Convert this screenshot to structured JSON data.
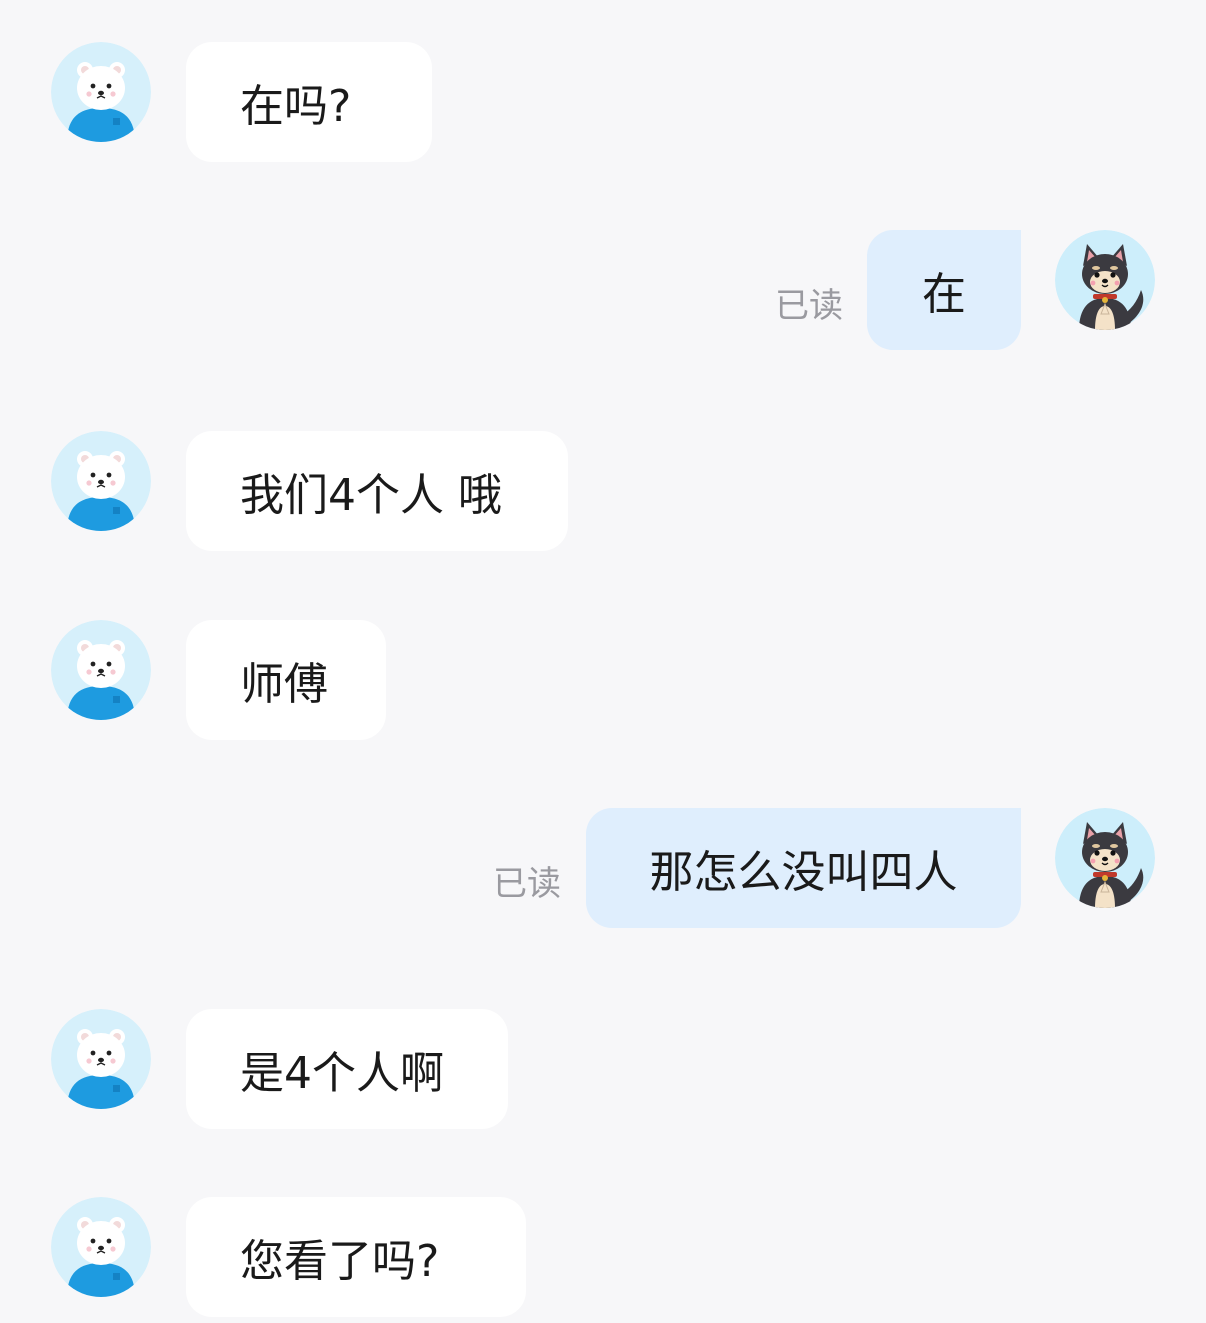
{
  "conversation": {
    "messages": [
      {
        "sender": "other",
        "text": "在吗?"
      },
      {
        "sender": "me",
        "text": "在",
        "status": "已读"
      },
      {
        "sender": "other",
        "text": "我们4个人 哦"
      },
      {
        "sender": "other",
        "text": "师傅"
      },
      {
        "sender": "me",
        "text": "那怎么没叫四人",
        "status": "已读"
      },
      {
        "sender": "other",
        "text": "是4个人啊"
      },
      {
        "sender": "other",
        "text": "您看了吗?"
      }
    ]
  },
  "avatars": {
    "other": {
      "icon": "polar-bear-avatar-icon",
      "bg_color": "#d6f0fb",
      "shirt_color": "#1e9be0"
    },
    "me": {
      "icon": "shiba-dog-avatar-icon",
      "bg_color": "#cdeefb",
      "fur_color": "#3b3a40"
    }
  },
  "colors": {
    "background": "#f7f7f9",
    "incoming_bubble": "#ffffff",
    "outgoing_bubble": "#dfeefd",
    "read_label": "#9a9aa0"
  }
}
